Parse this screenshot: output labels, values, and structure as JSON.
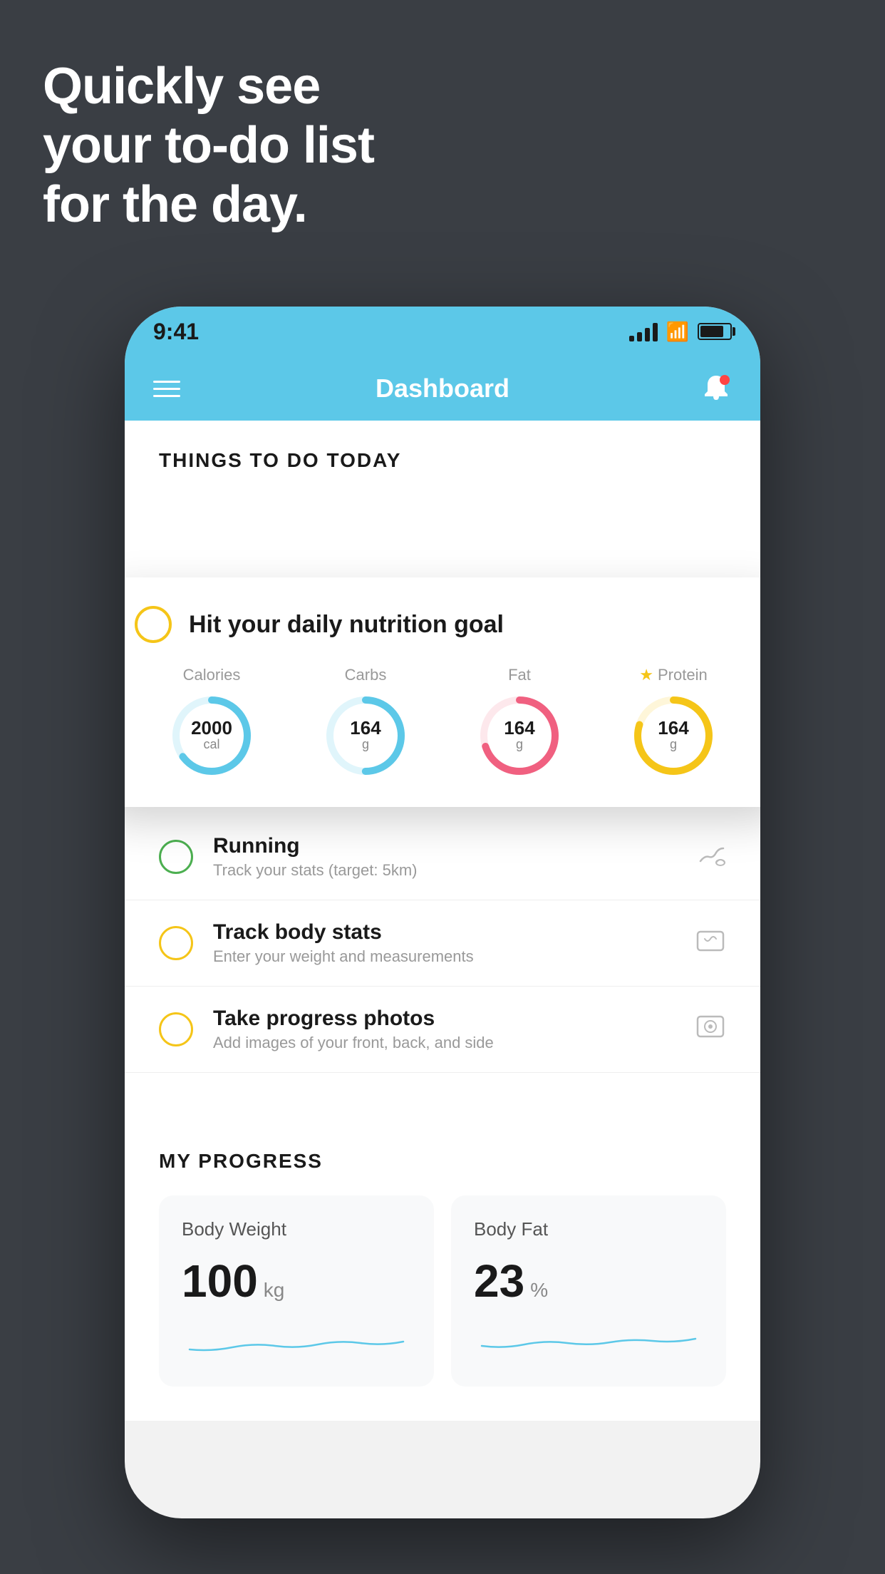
{
  "headline": {
    "line1": "Quickly see",
    "line2": "your to-do list",
    "line3": "for the day."
  },
  "status_bar": {
    "time": "9:41"
  },
  "header": {
    "title": "Dashboard"
  },
  "things_section": {
    "title": "THINGS TO DO TODAY"
  },
  "nutrition_card": {
    "check_label": "Hit your daily nutrition goal",
    "items": [
      {
        "label": "Calories",
        "value": "2000",
        "unit": "cal",
        "color": "#5cc8e8",
        "track_color": "#e0f5fb",
        "percent": 65
      },
      {
        "label": "Carbs",
        "value": "164",
        "unit": "g",
        "color": "#5cc8e8",
        "track_color": "#e0f5fb",
        "percent": 50
      },
      {
        "label": "Fat",
        "value": "164",
        "unit": "g",
        "color": "#f06080",
        "track_color": "#fde8ec",
        "percent": 70
      },
      {
        "label": "Protein",
        "value": "164",
        "unit": "g",
        "color": "#f5c518",
        "track_color": "#fef6d9",
        "percent": 80,
        "starred": true
      }
    ]
  },
  "todo_items": [
    {
      "id": "running",
      "title": "Running",
      "subtitle": "Track your stats (target: 5km)",
      "circle_color": "green",
      "icon": "👟"
    },
    {
      "id": "body-stats",
      "title": "Track body stats",
      "subtitle": "Enter your weight and measurements",
      "circle_color": "yellow",
      "icon": "⚖️"
    },
    {
      "id": "progress-photos",
      "title": "Take progress photos",
      "subtitle": "Add images of your front, back, and side",
      "circle_color": "yellow",
      "icon": "👤"
    }
  ],
  "progress_section": {
    "title": "MY PROGRESS",
    "cards": [
      {
        "id": "body-weight",
        "title": "Body Weight",
        "value": "100",
        "unit": "kg"
      },
      {
        "id": "body-fat",
        "title": "Body Fat",
        "value": "23",
        "unit": "%"
      }
    ]
  }
}
